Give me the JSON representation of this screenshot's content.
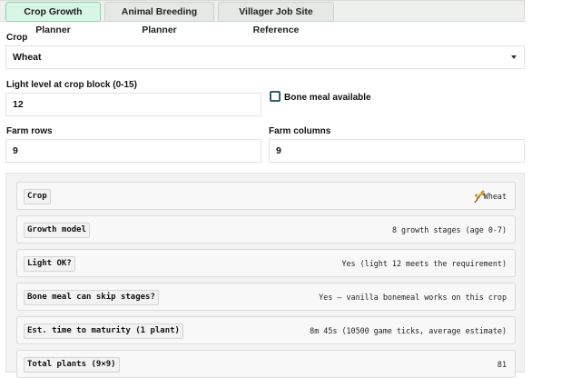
{
  "tabs": [
    {
      "label": "Crop Growth Planner",
      "active": true
    },
    {
      "label": "Animal Breeding Planner",
      "active": false
    },
    {
      "label": "Villager Job Site Reference",
      "active": false
    }
  ],
  "form": {
    "crop": {
      "label": "Crop",
      "value": "Wheat"
    },
    "light": {
      "label": "Light level at crop block (0-15)",
      "value": "12"
    },
    "bonemeal": {
      "label": "Bone meal available",
      "checked": false
    },
    "rows": {
      "label": "Farm rows",
      "value": "9"
    },
    "cols": {
      "label": "Farm columns",
      "value": "9"
    }
  },
  "results": [
    {
      "key": "Crop",
      "value": "Wheat",
      "icon": "wheat-icon"
    },
    {
      "key": "Growth model",
      "value": "8 growth stages (age 0-7)"
    },
    {
      "key": "Light OK?",
      "value": "Yes (light 12 meets the requirement)"
    },
    {
      "key": "Bone meal can skip stages?",
      "value": "Yes — vanilla bonemeal works on this crop"
    },
    {
      "key": "Est. time to maturity (1 plant)",
      "value": "8m 45s (10500 game ticks, average estimate)"
    },
    {
      "key": "Total plants (9×9)",
      "value": "81"
    }
  ],
  "colors": {
    "active_tab": "#d9f5e6",
    "checkbox_border": "#2f5f68"
  }
}
